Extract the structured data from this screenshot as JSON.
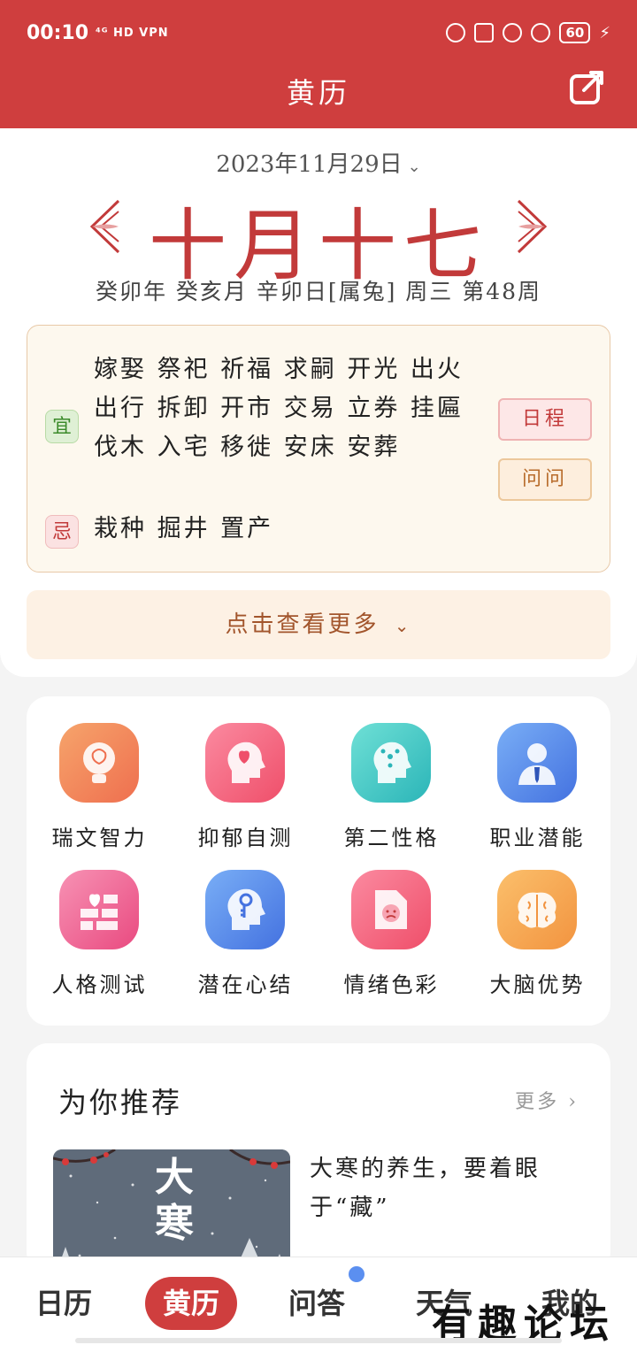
{
  "status_bar": {
    "time": "00:10",
    "signal_text": "⁴ᴳ HD VPN",
    "battery": "60",
    "icons": [
      "mute-icon",
      "card-icon",
      "lock-icon",
      "alarm-icon",
      "battery-icon",
      "charging-icon"
    ]
  },
  "header": {
    "title": "黄历",
    "share_icon": "share-icon"
  },
  "almanac": {
    "date": "2023年11月29日",
    "lunar_date": "十月十七",
    "ganzhi": "癸卯年 癸亥月 辛卯日[属兔] 周三 第48周",
    "yi_label": "宜",
    "yi_text": "嫁娶 祭祀 祈福 求嗣 开光 出火 出行 拆卸 开市 交易 立券 挂匾 伐木 入宅 移徙 安床 安葬",
    "ji_label": "忌",
    "ji_text": "栽种 掘井 置产",
    "schedule_btn": "日程",
    "ask_btn": "问问",
    "more_text": "点击查看更多"
  },
  "tools": [
    {
      "label": "瑞文智力",
      "icon": "brain-bulb-icon",
      "color_a": "#f6a46b",
      "color_b": "#ef6f4f"
    },
    {
      "label": "抑郁自测",
      "icon": "broken-heart-head-icon",
      "color_a": "#fb8aa0",
      "color_b": "#ef4f6a"
    },
    {
      "label": "第二性格",
      "icon": "molecule-head-icon",
      "color_a": "#6fe0d6",
      "color_b": "#2bb5b8"
    },
    {
      "label": "职业潜能",
      "icon": "businessman-icon",
      "color_a": "#79aef6",
      "color_b": "#4472e0"
    },
    {
      "label": "人格测试",
      "icon": "heart-bricks-icon",
      "color_a": "#f792b4",
      "color_b": "#e94a80"
    },
    {
      "label": "潜在心结",
      "icon": "key-head-icon",
      "color_a": "#79aef6",
      "color_b": "#4472e0"
    },
    {
      "label": "情绪色彩",
      "icon": "sad-document-icon",
      "color_a": "#fb8aa0",
      "color_b": "#ef4f6a"
    },
    {
      "label": "大脑优势",
      "icon": "brain-icon",
      "color_a": "#fbbf6b",
      "color_b": "#f29440"
    }
  ],
  "recommend": {
    "title": "为你推荐",
    "more": "更多",
    "article_title": "大寒的养生，要着眼于“藏”",
    "thumb_text": "大寒"
  },
  "tabbar": {
    "items": [
      "日历",
      "黄历",
      "问答",
      "天气",
      "我的"
    ],
    "active": "黄历"
  },
  "watermark": "有趣论坛"
}
